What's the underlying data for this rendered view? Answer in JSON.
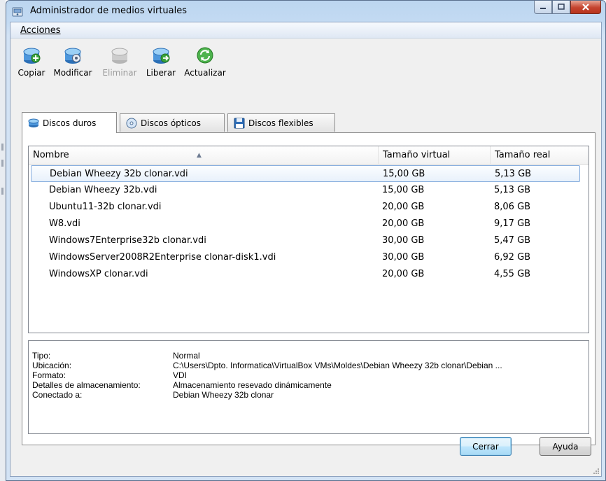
{
  "window": {
    "title": "Administrador de medios virtuales"
  },
  "menu": {
    "acciones": "Acciones"
  },
  "toolbar": {
    "copiar": "Copiar",
    "modificar": "Modificar",
    "eliminar": "Eliminar",
    "liberar": "Liberar",
    "actualizar": "Actualizar"
  },
  "tabs": {
    "discos_duros": "Discos duros",
    "discos_opticos": "Discos ópticos",
    "discos_flexibles": "Discos flexibles"
  },
  "table": {
    "headers": [
      "Nombre",
      "Tamaño virtual",
      "Tamaño real"
    ],
    "rows": [
      {
        "name": "Debian Wheezy 32b clonar.vdi",
        "virtual": "15,00 GB",
        "real": "5,13 GB"
      },
      {
        "name": "Debian Wheezy 32b.vdi",
        "virtual": "15,00 GB",
        "real": "5,13 GB"
      },
      {
        "name": "Ubuntu11-32b clonar.vdi",
        "virtual": "20,00 GB",
        "real": "8,06 GB"
      },
      {
        "name": "W8.vdi",
        "virtual": "20,00 GB",
        "real": "9,17 GB"
      },
      {
        "name": "Windows7Enterprise32b clonar.vdi",
        "virtual": "30,00 GB",
        "real": "5,47 GB"
      },
      {
        "name": "WindowsServer2008R2Enterprise clonar-disk1.vdi",
        "virtual": "30,00 GB",
        "real": "6,92 GB"
      },
      {
        "name": "WindowsXP clonar.vdi",
        "virtual": "20,00 GB",
        "real": "4,55 GB"
      }
    ]
  },
  "details": {
    "tipo_label": "Tipo:",
    "tipo_value": "Normal",
    "ubicacion_label": "Ubicación:",
    "ubicacion_value": "C:\\Users\\Dpto. Informatica\\VirtualBox VMs\\Moldes\\Debian Wheezy 32b clonar\\Debian ...",
    "formato_label": "Formato:",
    "formato_value": "VDI",
    "detalles_label": "Detalles de almacenamiento:",
    "detalles_value": "Almacenamiento resevado dinámicamente",
    "conectado_label": "Conectado a:",
    "conectado_value": "Debian Wheezy 32b clonar"
  },
  "buttons": {
    "cerrar": "Cerrar",
    "ayuda": "Ayuda"
  },
  "colors": {
    "selection_border": "#84acdd",
    "close_button": "#c5432e"
  },
  "icons": [
    "vbox-window-icon",
    "copy-disk-icon",
    "modify-disk-icon",
    "remove-disk-icon",
    "release-disk-icon",
    "refresh-icon",
    "hard-disk-icon",
    "optical-disc-icon",
    "floppy-disk-icon"
  ]
}
